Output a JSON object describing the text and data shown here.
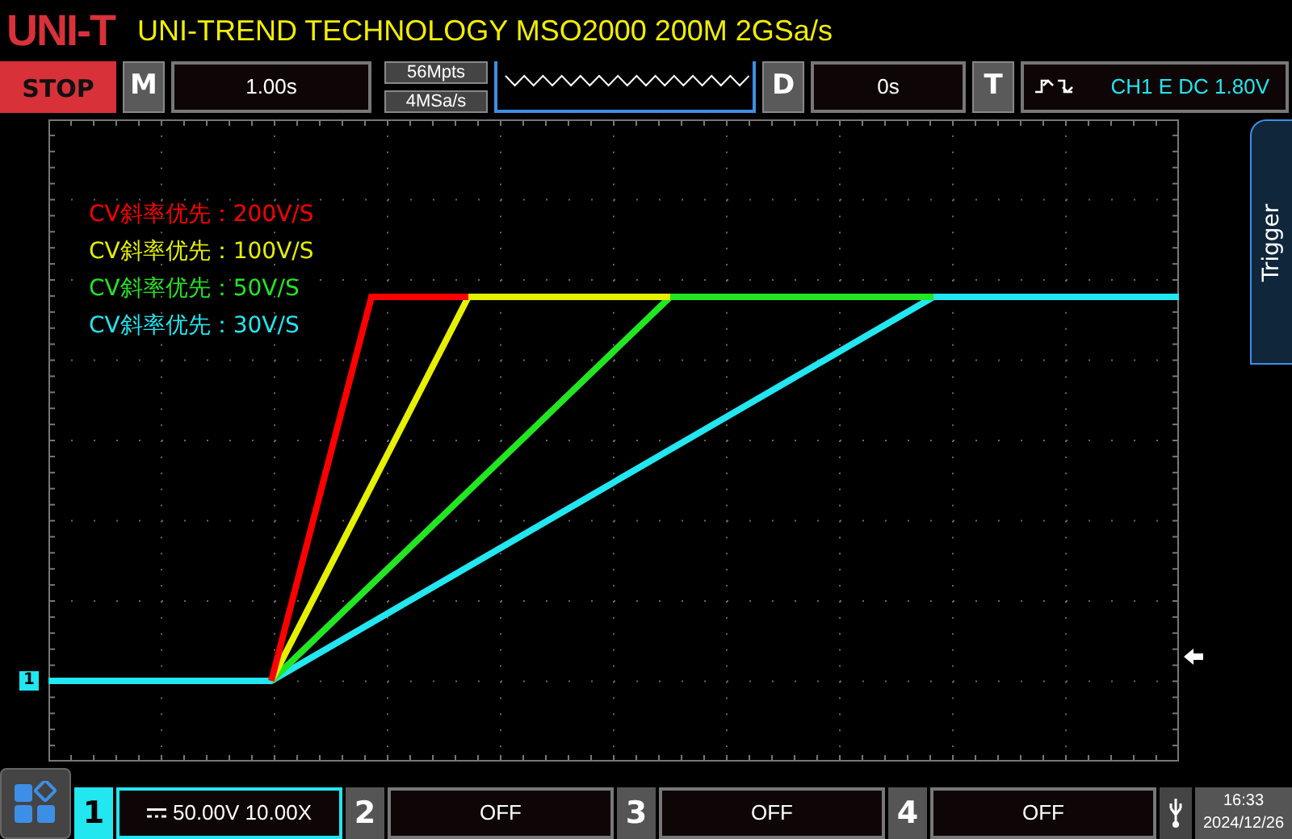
{
  "brand": {
    "logo": "UNI-T",
    "title": "UNI-TREND TECHNOLOGY MSO2000 200M 2GSa/s"
  },
  "toolbar": {
    "run_state": "STOP",
    "horizontal": {
      "key": "M",
      "value": "1.00s"
    },
    "memory_depth": "56Mpts",
    "sample_rate": "4MSa/s",
    "delay": {
      "key": "D",
      "value": "0s"
    },
    "trigger": {
      "key": "T",
      "value": "CH1 E DC 1.80V"
    }
  },
  "plot": {
    "channel_marker": "1",
    "traces": [
      {
        "label": "CV斜率优先：200V/S",
        "color": "#ff0000"
      },
      {
        "label": "CV斜率优先：100V/S",
        "color": "#e6f000"
      },
      {
        "label": "CV斜率优先：50V/S",
        "color": "#22e622"
      },
      {
        "label": "CV斜率优先：30V/S",
        "color": "#22e6f0"
      }
    ]
  },
  "side_tab": "Trigger",
  "channels": [
    {
      "number": "1",
      "value": "50.00V 10.00X",
      "selected": true
    },
    {
      "number": "2",
      "value": "OFF",
      "selected": false
    },
    {
      "number": "3",
      "value": "OFF",
      "selected": false
    },
    {
      "number": "4",
      "value": "OFF",
      "selected": false
    }
  ],
  "clock": {
    "time": "16:33",
    "date": "2024/12/26"
  }
}
